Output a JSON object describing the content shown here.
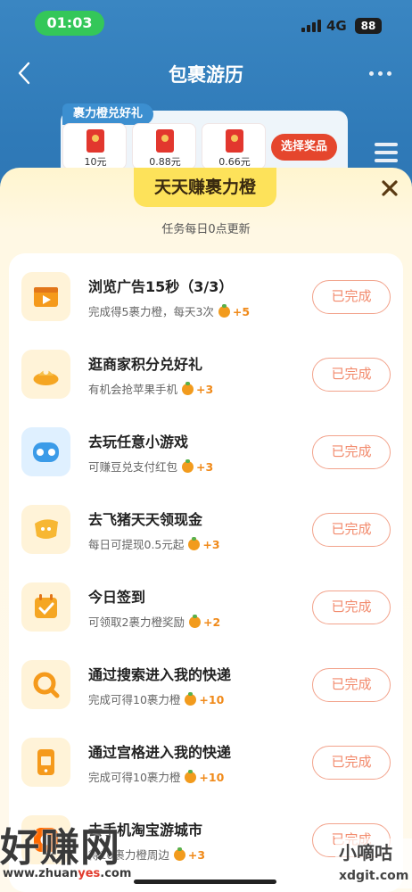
{
  "status_bar": {
    "time": "01:03",
    "network": "4G",
    "battery": "88"
  },
  "nav": {
    "title": "包裹游历"
  },
  "rewards": {
    "tag": "裹力橙兑好礼",
    "items": [
      {
        "amount": "10元"
      },
      {
        "amount": "0.88元"
      },
      {
        "amount": "0.66元"
      }
    ],
    "choose_label": "选择奖品"
  },
  "sheet": {
    "title": "天天赚裹力橙",
    "subtitle": "任务每日0点更新"
  },
  "tasks": [
    {
      "name": "浏览广告15秒（3/3）",
      "desc": "完成得5裹力橙，每天3次",
      "points": "+5",
      "button": "已完成",
      "icon": "video-icon"
    },
    {
      "name": "逛商家积分兑好礼",
      "desc": "有机会抢苹果手机",
      "points": "+3",
      "button": "已完成",
      "icon": "gold-ingot-icon"
    },
    {
      "name": "去玩任意小游戏",
      "desc": "可赚豆兑支付红包",
      "points": "+3",
      "button": "已完成",
      "icon": "game-controller-icon"
    },
    {
      "name": "去飞猪天天领现金",
      "desc": "每日可提现0.5元起",
      "points": "+3",
      "button": "已完成",
      "icon": "fliggy-icon"
    },
    {
      "name": "今日签到",
      "desc": "可领取2裹力橙奖励",
      "points": "+2",
      "button": "已完成",
      "icon": "calendar-check-icon"
    },
    {
      "name": "通过搜索进入我的快递",
      "desc": "完成可得10裹力橙",
      "points": "+10",
      "button": "已完成",
      "icon": "search-icon"
    },
    {
      "name": "通过宫格进入我的快递",
      "desc": "完成可得10裹力橙",
      "points": "+10",
      "button": "已完成",
      "icon": "phone-package-icon"
    },
    {
      "name": "去手机淘宝游城市",
      "desc": "得10裹力橙周边",
      "points": "+3",
      "button": "已完成",
      "icon": "taobao-icon"
    }
  ],
  "watermarks": {
    "left_big": "好赚网",
    "left_url_a": "www.zhuan",
    "left_url_b": "yes",
    "left_url_c": ".com",
    "right_cn": "小嘀咕",
    "right_en": "xdgit.com"
  },
  "colors": {
    "accent": "#e5462d",
    "header_blue": "#2f7ab8",
    "done_border": "#f2a38c",
    "title_yellow": "#fde25a"
  }
}
